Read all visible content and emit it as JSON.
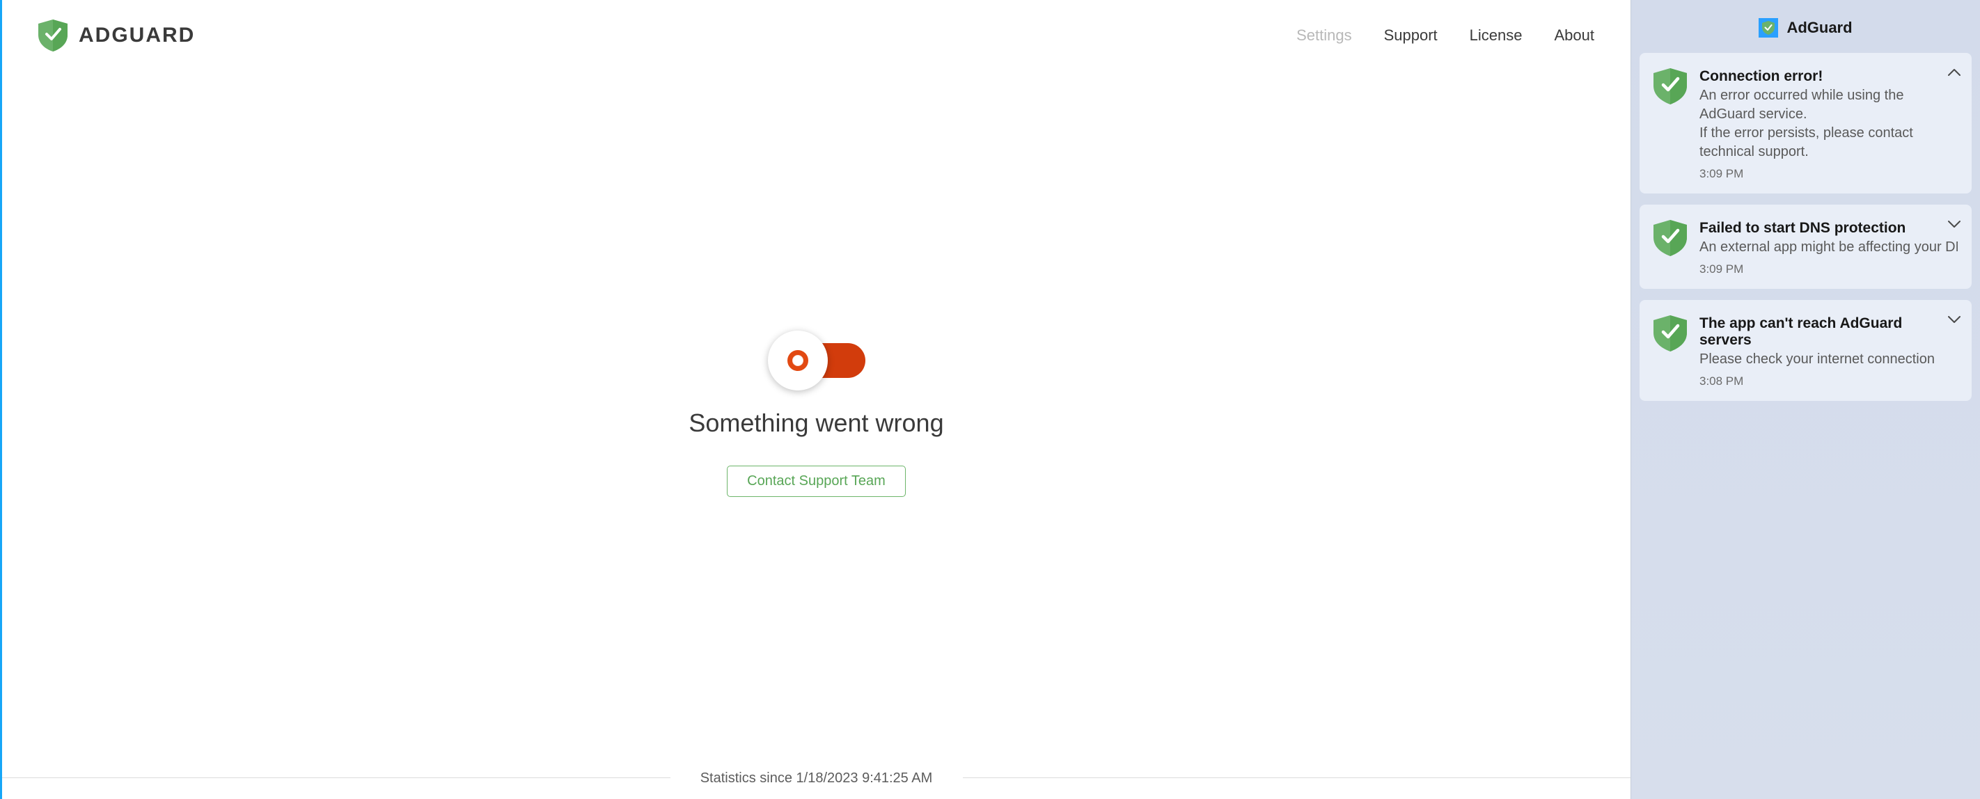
{
  "brand": {
    "name": "ADGUARD"
  },
  "nav": {
    "settings": "Settings",
    "support": "Support",
    "license": "License",
    "about": "About"
  },
  "main": {
    "error_title": "Something went wrong",
    "contact_button": "Contact Support Team",
    "stats_line": "Statistics since 1/18/2023 9:41:25 AM"
  },
  "notif_panel": {
    "title": "AdGuard",
    "items": [
      {
        "title": "Connection error!",
        "desc": "An error occurred while using the AdGuard service.\nIf the error persists, please contact technical support.",
        "time": "3:09 PM",
        "expanded": true
      },
      {
        "title": "Failed to start DNS protection",
        "desc": "An external app might be affecting your DNS",
        "time": "3:09 PM",
        "expanded": false
      },
      {
        "title": "The app can't reach AdGuard servers",
        "desc": "Please check your internet connection",
        "time": "3:08 PM",
        "expanded": false
      }
    ]
  }
}
